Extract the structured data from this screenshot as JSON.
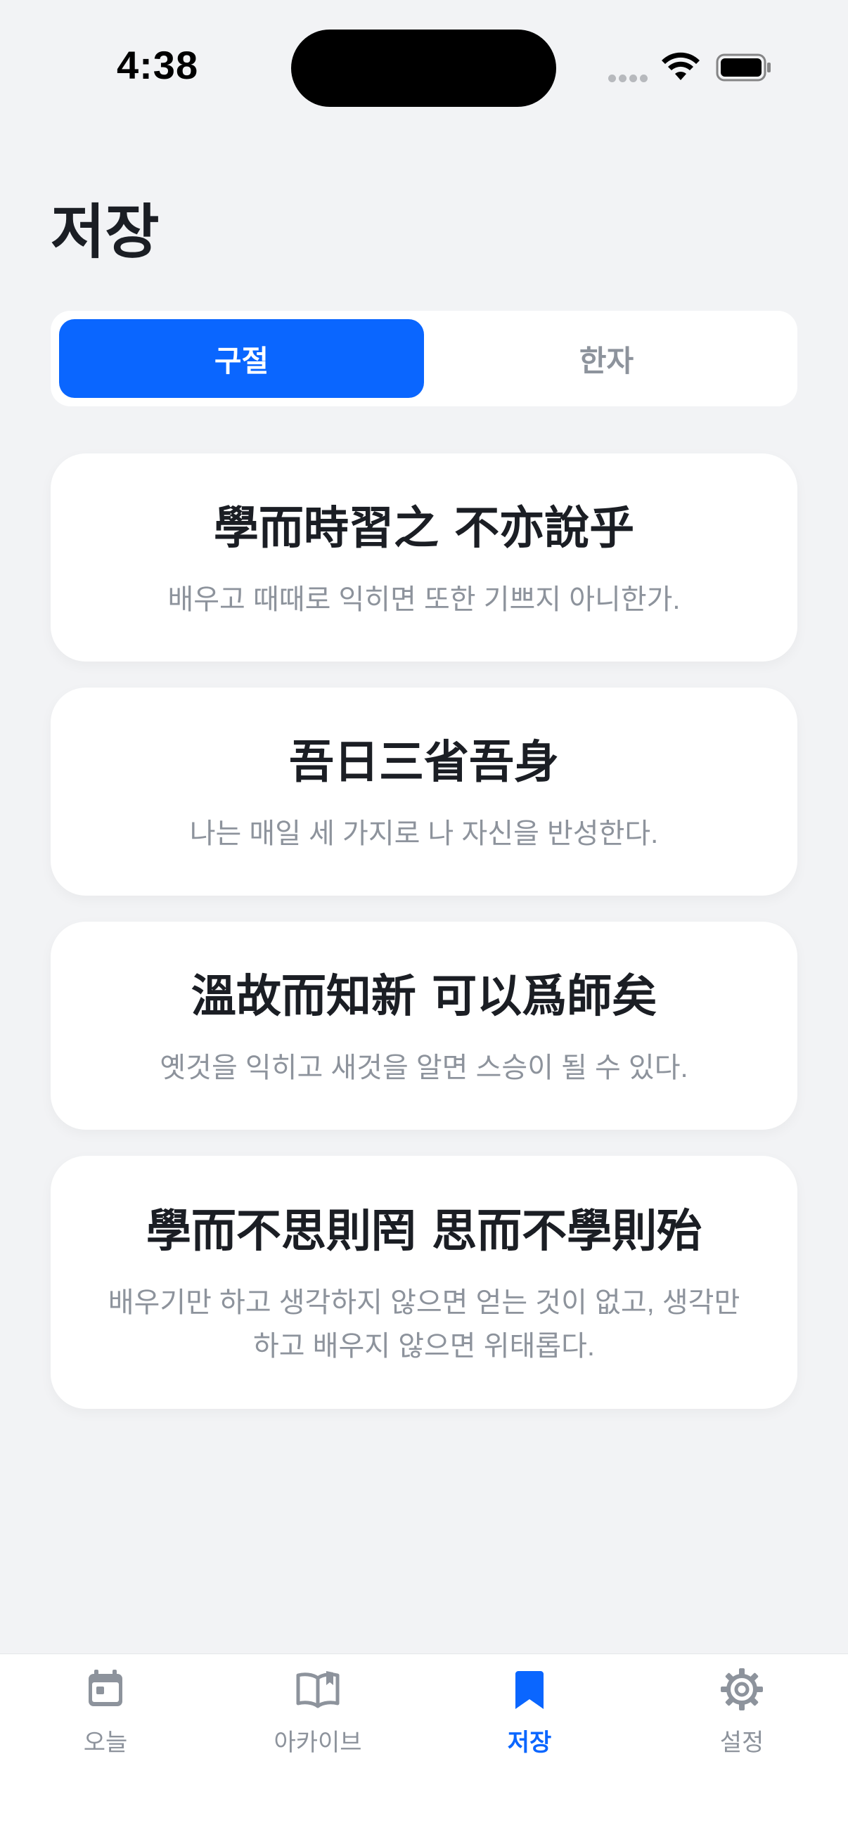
{
  "status_bar": {
    "time": "4:38"
  },
  "header": {
    "title": "저장"
  },
  "segmented_control": {
    "options": [
      "구절",
      "한자"
    ],
    "selected": "구절"
  },
  "saved_phrases": [
    {
      "hanja": "學而時習之 不亦說乎",
      "meaning": "배우고 때때로 익히면 또한 기쁘지 아니한가."
    },
    {
      "hanja": "吾日三省吾身",
      "meaning": "나는 매일 세 가지로 나 자신을 반성한다."
    },
    {
      "hanja": "溫故而知新 可以爲師矣",
      "meaning": "옛것을 익히고 새것을 알면 스승이 될 수 있다."
    },
    {
      "hanja": "學而不思則罔 思而不學則殆",
      "meaning": "배우기만 하고 생각하지 않으면 얻는 것이 없고, 생각만 하고 배우지 않으면 위태롭다."
    }
  ],
  "tab_bar": {
    "items": [
      {
        "label": "오늘",
        "icon": "calendar-icon"
      },
      {
        "label": "아카이브",
        "icon": "book-icon"
      },
      {
        "label": "저장",
        "icon": "bookmark-icon"
      },
      {
        "label": "설정",
        "icon": "gear-icon"
      }
    ],
    "active": "저장"
  },
  "colors": {
    "accent": "#0a66ff",
    "background": "#f2f3f5",
    "card": "#ffffff",
    "muted_text": "#8d939c",
    "primary_text": "#1b1e24"
  }
}
